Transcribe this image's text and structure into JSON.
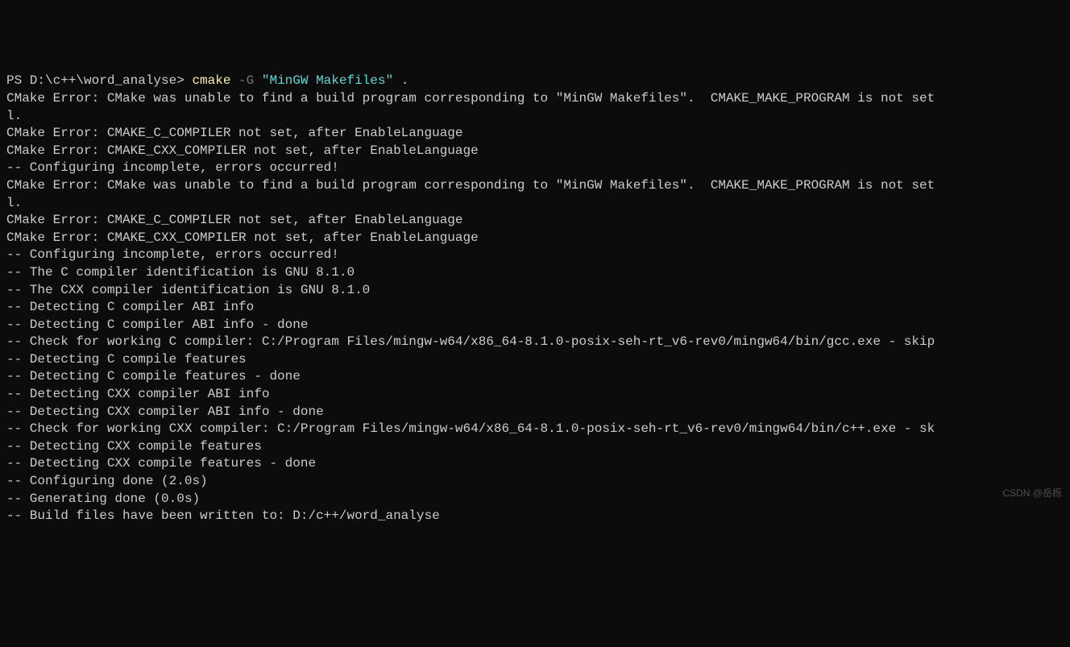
{
  "prompt": {
    "path": "PS D:\\c++\\word_analyse> ",
    "cmd": "cmake",
    "flag": " -G ",
    "arg": "\"MinGW Makefiles\"",
    "dot": " ."
  },
  "lines": {
    "l1": "CMake Error: CMake was unable to find a build program corresponding to \"MinGW Makefiles\".  CMAKE_MAKE_PROGRAM is not set",
    "l2": "l.",
    "l3": "CMake Error: CMAKE_C_COMPILER not set, after EnableLanguage",
    "l4": "CMake Error: CMAKE_CXX_COMPILER not set, after EnableLanguage",
    "l5": "-- Configuring incomplete, errors occurred!",
    "l6": "CMake Error: CMake was unable to find a build program corresponding to \"MinGW Makefiles\".  CMAKE_MAKE_PROGRAM is not set",
    "l7": "l.",
    "l8": "CMake Error: CMAKE_C_COMPILER not set, after EnableLanguage",
    "l9": "CMake Error: CMAKE_CXX_COMPILER not set, after EnableLanguage",
    "l10": "-- Configuring incomplete, errors occurred!",
    "l11": "-- The C compiler identification is GNU 8.1.0",
    "l12": "-- The CXX compiler identification is GNU 8.1.0",
    "l13": "-- Detecting C compiler ABI info",
    "l14": "-- Detecting C compiler ABI info - done",
    "l15": "-- Check for working C compiler: C:/Program Files/mingw-w64/x86_64-8.1.0-posix-seh-rt_v6-rev0/mingw64/bin/gcc.exe - skip",
    "l16": "-- Detecting C compile features",
    "l17": "-- Detecting C compile features - done",
    "l18": "-- Detecting CXX compiler ABI info",
    "l19": "-- Detecting CXX compiler ABI info - done",
    "l20": "-- Check for working CXX compiler: C:/Program Files/mingw-w64/x86_64-8.1.0-posix-seh-rt_v6-rev0/mingw64/bin/c++.exe - sk",
    "l21": "-- Detecting CXX compile features",
    "l22": "-- Detecting CXX compile features - done",
    "l23": "-- Configuring done (2.0s)",
    "l24": "-- Generating done (0.0s)",
    "l25": "-- Build files have been written to: D:/c++/word_analyse"
  },
  "watermark": "CSDN @岳栎"
}
